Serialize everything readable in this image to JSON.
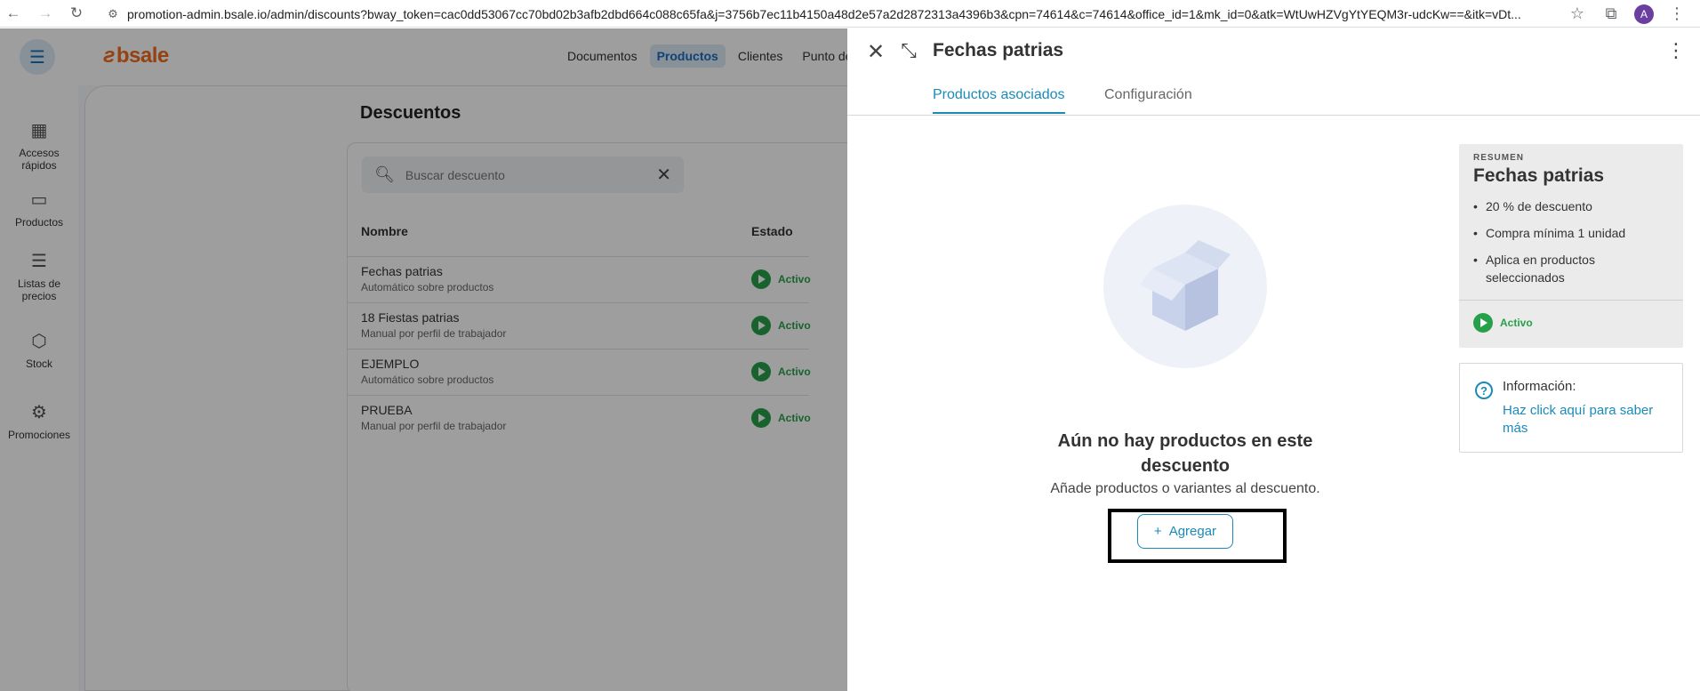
{
  "browser": {
    "url": "promotion-admin.bsale.io/admin/discounts?bway_token=cac0dd53067cc70bd02b3afb2dbd664c088c65fa&j=3756b7ec11b4150a48d2e57a2d2872313a4396b3&cpn=74614&c=74614&office_id=1&mk_id=0&atk=WtUwHZVgYtYEQM3r-udcKw==&itk=vDt...",
    "profile_initial": "A"
  },
  "app": {
    "logo": "bsale",
    "topnav": [
      "Documentos",
      "Productos",
      "Clientes",
      "Punto de"
    ],
    "leftnav": [
      {
        "label": "Accesos rápidos",
        "icon": "grid-icon"
      },
      {
        "label": "Productos",
        "icon": "products-icon"
      },
      {
        "label": "Listas de precios",
        "icon": "price-list-icon"
      },
      {
        "label": "Stock",
        "icon": "box-icon"
      },
      {
        "label": "Promociones",
        "icon": "promotion-icon"
      }
    ],
    "page_title": "Descuentos",
    "search_placeholder": "Buscar descuento",
    "columns": {
      "name": "Nombre",
      "status": "Estado"
    },
    "rows": [
      {
        "name": "Fechas patrias",
        "type": "Automático sobre productos",
        "status": "Activo"
      },
      {
        "name": "18 Fiestas patrias",
        "type": "Manual por perfil de trabajador",
        "status": "Activo"
      },
      {
        "name": "EJEMPLO",
        "type": "Automático sobre productos",
        "status": "Activo"
      },
      {
        "name": "PRUEBA",
        "type": "Manual por perfil de trabajador",
        "status": "Activo"
      }
    ]
  },
  "drawer": {
    "title": "Fechas patrias",
    "tabs": [
      "Productos asociados",
      "Configuración"
    ],
    "empty_title": "Aún no hay productos en este descuento",
    "empty_subtitle": "Añade productos o variantes al descuento.",
    "add_button": "Agregar",
    "summary": {
      "label": "RESUMEN",
      "title": "Fechas patrias",
      "items": [
        "20 % de descuento",
        "Compra mínima 1 unidad",
        "Aplica en productos seleccionados"
      ],
      "status": "Activo"
    },
    "info": {
      "title": "Información:",
      "link": "Haz click aquí para saber más"
    }
  },
  "colors": {
    "accent": "#1a8bb8",
    "brand": "#f06a1d",
    "active_status": "#27a04a"
  }
}
